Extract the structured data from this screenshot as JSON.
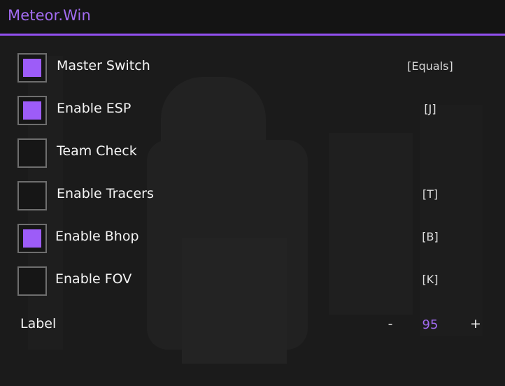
{
  "window": {
    "title": "Meteor.Win",
    "accent_color": "#9350f0",
    "title_color": "#a36cf2"
  },
  "toggles": [
    {
      "label": "Master Switch",
      "checked": true,
      "keybind": "[Equals]"
    },
    {
      "label": "Enable ESP",
      "checked": true,
      "keybind": "[J]"
    },
    {
      "label": "Team Check",
      "checked": false,
      "keybind": ""
    },
    {
      "label": "Enable Tracers",
      "checked": false,
      "keybind": "[T]"
    },
    {
      "label": "Enable Bhop",
      "checked": true,
      "keybind": "[B]"
    },
    {
      "label": "Enable FOV",
      "checked": false,
      "keybind": "[K]"
    }
  ],
  "slider": {
    "label": "Label",
    "minus": "-",
    "value": "95",
    "plus": "+"
  },
  "checkbox_color": "#9d5cf8"
}
